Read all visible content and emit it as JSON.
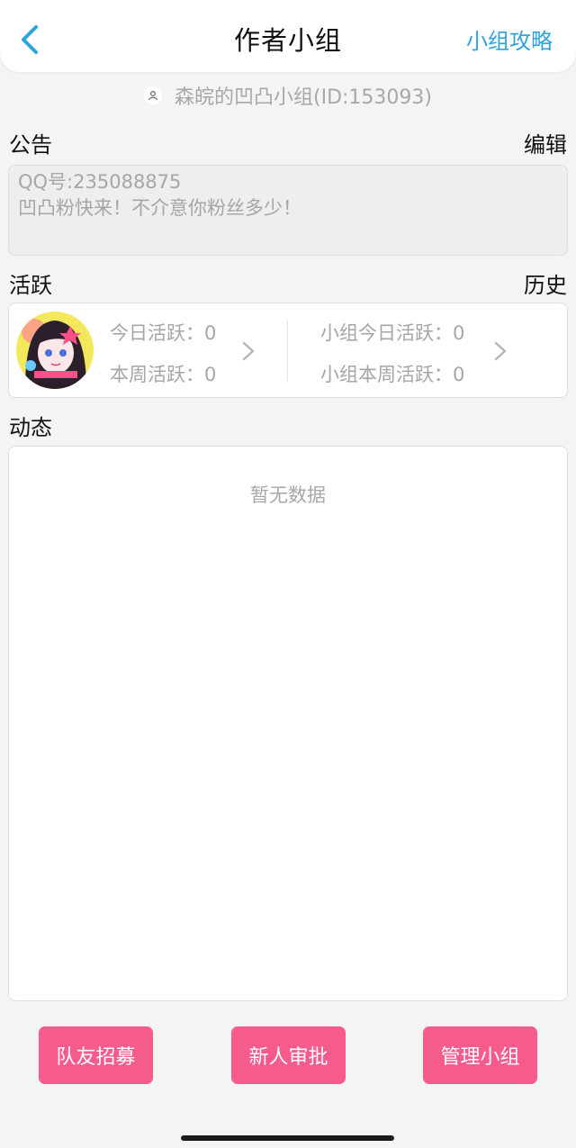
{
  "nav": {
    "title": "作者小组",
    "right_link": "小组攻略"
  },
  "group": {
    "name_line": "森皖的凹凸小组(ID:153093)"
  },
  "notice": {
    "label": "公告",
    "edit_label": "编辑",
    "lines": [
      "QQ号:235088875",
      "凹凸粉快来！不介意你粉丝多少！"
    ]
  },
  "activity": {
    "label": "活跃",
    "history_label": "历史",
    "personal_today": "今日活跃：0",
    "personal_week": "本周活跃：0",
    "group_today": "小组今日活跃：0",
    "group_week": "小组本周活跃：0"
  },
  "feed": {
    "label": "动态",
    "empty_text": "暂无数据"
  },
  "actions": {
    "recruit_label": "队友招募",
    "approve_label": "新人审批",
    "manage_label": "管理小组"
  },
  "colors": {
    "accent": "#2ea3dc",
    "button": "#f55c8c",
    "background": "#f4f4f4"
  }
}
